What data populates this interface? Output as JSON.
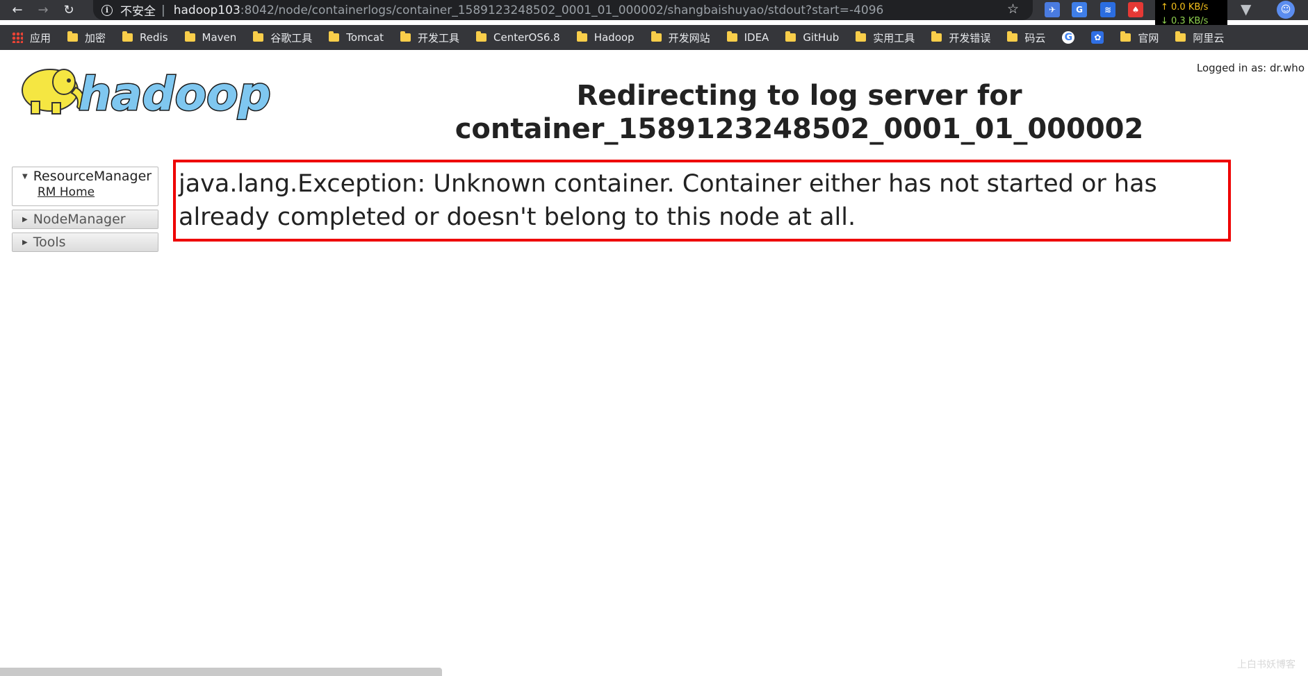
{
  "browser": {
    "insecure_label": "不安全",
    "url_separator": "|",
    "url_host": "hadoop103",
    "url_rest": ":8042/node/containerlogs/container_1589123248502_0001_01_000002/shangbaishuyao/stdout?start=-4096",
    "net_up": "↑ 0.0 KB/s",
    "net_down": "↓ 0.3 KB/s"
  },
  "bookmarks": [
    {
      "label": "应用",
      "icon": "apps-icon"
    },
    {
      "label": "加密",
      "icon": "folder-icon"
    },
    {
      "label": "Redis",
      "icon": "folder-icon"
    },
    {
      "label": "Maven",
      "icon": "folder-icon"
    },
    {
      "label": "谷歌工具",
      "icon": "folder-icon"
    },
    {
      "label": "Tomcat",
      "icon": "folder-icon"
    },
    {
      "label": "开发工具",
      "icon": "folder-icon"
    },
    {
      "label": "CenterOS6.8",
      "icon": "folder-icon"
    },
    {
      "label": "Hadoop",
      "icon": "folder-icon"
    },
    {
      "label": "开发网站",
      "icon": "folder-icon"
    },
    {
      "label": "IDEA",
      "icon": "folder-icon"
    },
    {
      "label": "GitHub",
      "icon": "folder-icon"
    },
    {
      "label": "实用工具",
      "icon": "folder-icon"
    },
    {
      "label": "开发错误",
      "icon": "folder-icon"
    },
    {
      "label": "码云",
      "icon": "folder-icon"
    },
    {
      "label": "官网",
      "icon": "folder-icon"
    },
    {
      "label": "阿里云",
      "icon": "folder-icon"
    }
  ],
  "header": {
    "logo_text": "hadoop",
    "logged_in": "Logged in as: dr.who",
    "title": "Redirecting to log server for container_1589123248502_0001_01_000002"
  },
  "nav": {
    "resource_manager": "ResourceManager",
    "rm_home": "RM Home",
    "node_manager": "NodeManager",
    "tools": "Tools"
  },
  "error": {
    "message": "java.lang.Exception: Unknown container. Container either has not started or has already completed or doesn't belong to this node at all."
  },
  "watermark": "上白书妖博客",
  "colors": {
    "chrome_bg": "#35363a",
    "omnibox_bg": "#202124",
    "error_border": "#ee0000",
    "logo_blue": "#7fc7f0",
    "logo_yellow": "#f5e642"
  }
}
